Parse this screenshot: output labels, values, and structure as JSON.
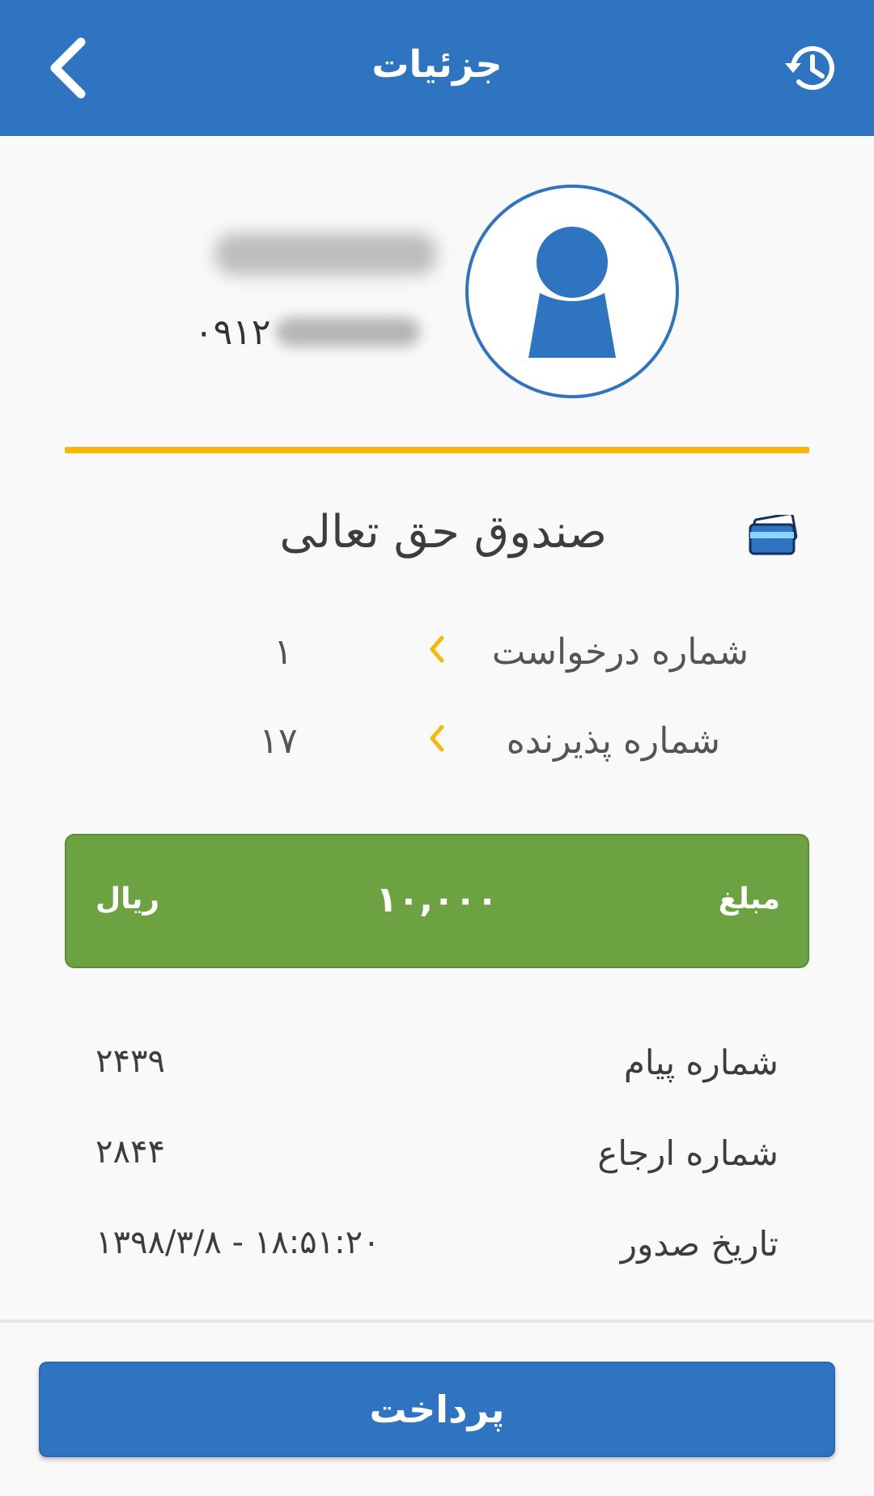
{
  "header": {
    "title": "جزئیات",
    "back_icon": "chevron-left-icon",
    "history_icon": "history-icon"
  },
  "profile": {
    "avatar_icon": "user-avatar-icon",
    "phone_prefix": "۰۹۱۲"
  },
  "merchant": {
    "name": "صندوق حق تعالی",
    "icon": "credit-card-icon"
  },
  "request_info": [
    {
      "label": "شماره درخواست",
      "value": "۱"
    },
    {
      "label": "شماره پذیرنده",
      "value": "۱۷"
    }
  ],
  "amount": {
    "label": "مبلغ",
    "value": "۱۰,۰۰۰",
    "currency": "ریال"
  },
  "details": [
    {
      "label": "شماره پیام",
      "value": "۲۴۳۹"
    },
    {
      "label": "شماره ارجاع",
      "value": "۲۸۴۴"
    },
    {
      "label": "تاریخ صدور",
      "value": "۱۳۹۸/۳/۸ - ۱۸:۵۱:۲۰"
    }
  ],
  "footer": {
    "pay_label": "پرداخت"
  },
  "colors": {
    "primary": "#2f74c0",
    "accent": "#f7b70c",
    "amount_bg": "#6ca241"
  }
}
